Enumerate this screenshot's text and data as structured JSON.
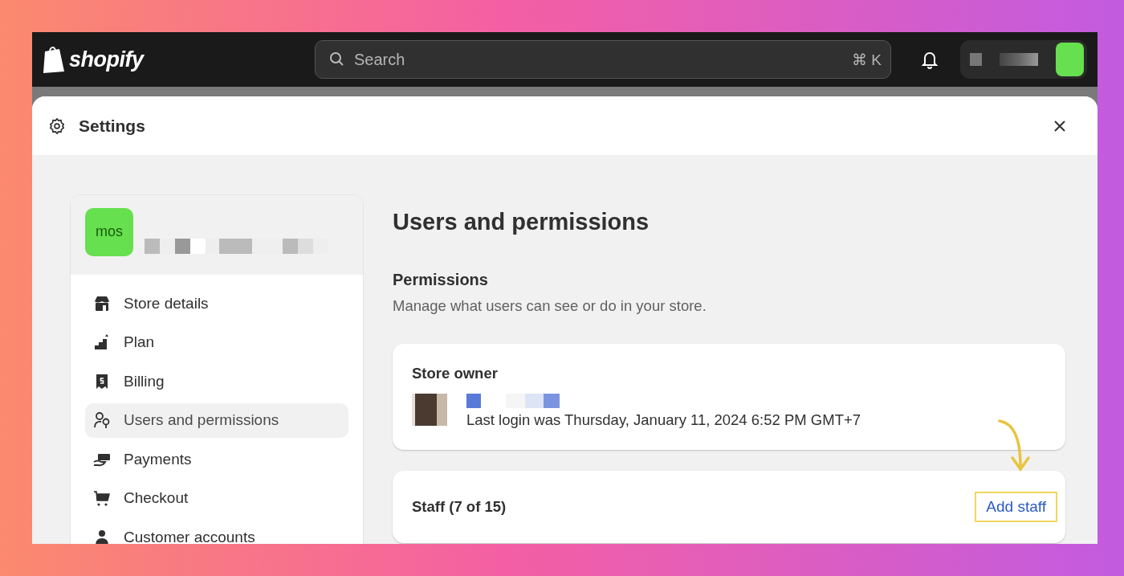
{
  "topbar": {
    "brand": "shopify",
    "search": {
      "placeholder": "Search",
      "shortcut": "⌘ K"
    }
  },
  "settings": {
    "title": "Settings"
  },
  "sidebar": {
    "store_avatar": "mos",
    "items": [
      {
        "label": "Store details",
        "kind": "store",
        "selected": false
      },
      {
        "label": "Plan",
        "kind": "plan",
        "selected": false
      },
      {
        "label": "Billing",
        "kind": "billing",
        "selected": false
      },
      {
        "label": "Users and permissions",
        "kind": "users",
        "selected": true
      },
      {
        "label": "Payments",
        "kind": "payments",
        "selected": false
      },
      {
        "label": "Checkout",
        "kind": "checkout",
        "selected": false
      },
      {
        "label": "Customer accounts",
        "kind": "customer",
        "selected": false
      }
    ]
  },
  "main": {
    "title": "Users and permissions",
    "section_title": "Permissions",
    "section_description": "Manage what users can see or do in your store.",
    "store_owner": {
      "title": "Store owner",
      "last_login": "Last login was Thursday, January 11, 2024 6:52 PM GMT+7"
    },
    "staff": {
      "title": "Staff (7 of 15)",
      "action": "Add staff"
    }
  }
}
